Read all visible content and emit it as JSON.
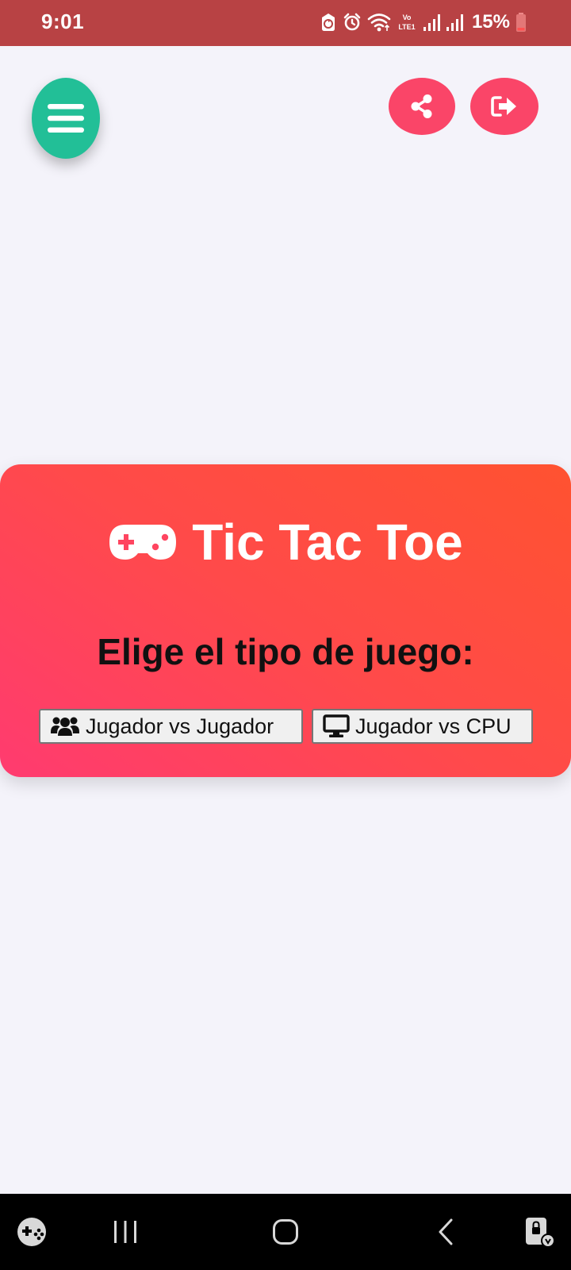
{
  "status_bar": {
    "time": "9:01",
    "battery": "15%",
    "network_label": "Vo LTE1",
    "icons": [
      "game-launcher-status-icon",
      "alarm-icon",
      "wifi-icon",
      "signal-icon",
      "signal-icon",
      "battery-icon"
    ]
  },
  "toolbar": {
    "menu_icon": "hamburger-icon",
    "share_icon": "share-icon",
    "logout_icon": "logout-icon"
  },
  "card": {
    "title": "Tic Tac Toe",
    "title_icon": "gamepad-icon",
    "subtitle": "Elige el tipo de juego:",
    "buttons": [
      {
        "label": "Jugador vs Jugador",
        "icon": "users-icon"
      },
      {
        "label": "Jugador vs CPU",
        "icon": "desktop-icon"
      }
    ]
  },
  "nav_bar": {
    "items": [
      "game-tools-icon",
      "recent-apps-icon",
      "home-icon",
      "back-icon",
      "screen-lock-icon"
    ]
  },
  "colors": {
    "status_bar": "#b84244",
    "menu_button": "#22bf97",
    "action_button": "#fa4568",
    "card_gradient_start": "#ff3b70",
    "card_gradient_end": "#ff5230",
    "background": "#f4f3fa"
  }
}
